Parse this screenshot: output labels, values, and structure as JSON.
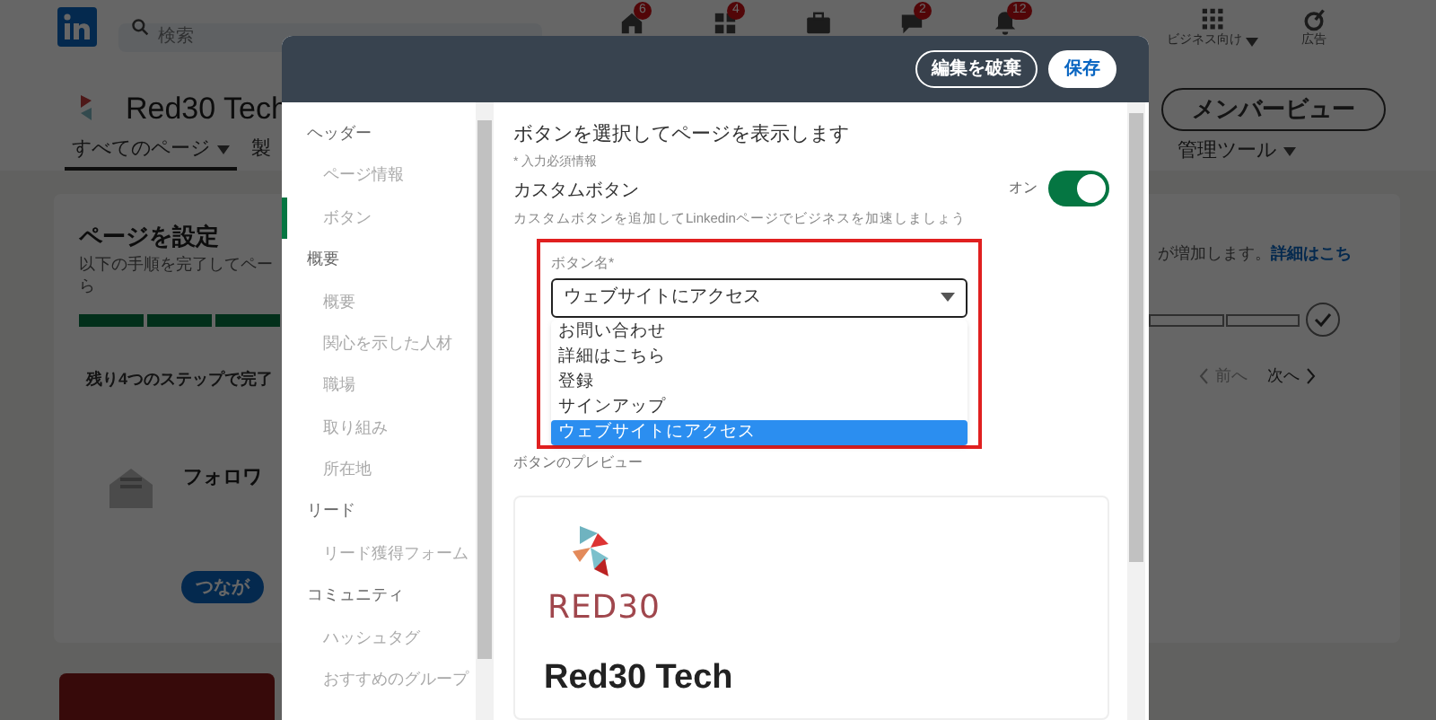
{
  "background_page": {
    "nav": {
      "search_placeholder": "検索",
      "items": [
        {
          "kind": "home",
          "badge": "6"
        },
        {
          "kind": "network",
          "badge": "4"
        },
        {
          "kind": "jobs"
        },
        {
          "kind": "messages",
          "badge": "2"
        },
        {
          "kind": "notifications",
          "badge": "12"
        }
      ],
      "business_label": "ビジネス向け",
      "ads_label": "広告"
    },
    "company_name": "Red30 Tech",
    "member_view_button": "メンバービュー",
    "tabs": [
      {
        "label": "すべてのページ",
        "selected": true
      },
      {
        "label": "製",
        "selected": false
      }
    ],
    "admin_tools": "管理ツール",
    "setup": {
      "title": "ページを設定",
      "description": "以下の手順を完了してペー",
      "description_cont": "ら",
      "description_right": "が増加します。",
      "link": "詳細はこち",
      "steps": [
        {
          "done": true
        },
        {
          "done": true
        },
        {
          "done": true
        },
        {
          "done": false
        },
        {
          "done": false
        }
      ],
      "remaining": "残り4つのステップで完了",
      "prev": "前へ",
      "next": "次へ"
    },
    "follower_card": {
      "title": "フォロワ",
      "button": "つなが"
    }
  },
  "modal": {
    "buttons": [
      {
        "label": "編集を破棄",
        "kind": "outline"
      },
      {
        "label": "保存",
        "kind": "primary"
      }
    ],
    "sidebar": [
      {
        "label": "ヘッダー",
        "children": [
          {
            "label": "ページ情報",
            "selected": false
          },
          {
            "label": "ボタン",
            "selected": true
          }
        ]
      },
      {
        "label": "概要",
        "children": [
          {
            "label": "概要",
            "selected": false
          },
          {
            "label": "関心を示した人材",
            "selected": false
          },
          {
            "label": "職場",
            "selected": false
          },
          {
            "label": "取り組み",
            "selected": false
          },
          {
            "label": "所在地",
            "selected": false
          }
        ]
      },
      {
        "label": "リード",
        "children": [
          {
            "label": "リード獲得フォーム",
            "selected": false
          }
        ]
      },
      {
        "label": "コミュニティ",
        "children": [
          {
            "label": "ハッシュタグ",
            "selected": false
          },
          {
            "label": "おすすめのグループ",
            "selected": false
          }
        ]
      }
    ],
    "heading": "ボタンを選択してページを表示します",
    "required_note": "* 入力必須情報",
    "custom_button": {
      "label": "カスタムボタン",
      "description": "カスタムボタンを追加してLinkedinページでビジネスを加速しましょう",
      "toggle_label": "オン",
      "on": true
    },
    "button_name": {
      "label": "ボタン名*",
      "value": "ウェブサイトにアクセス",
      "expanded": true,
      "options": [
        {
          "label": "お問い合わせ",
          "selected": false
        },
        {
          "label": "詳細はこちら",
          "selected": false
        },
        {
          "label": "登録",
          "selected": false
        },
        {
          "label": "サインアップ",
          "selected": false
        },
        {
          "label": "ウェブサイトにアクセス",
          "selected": true
        }
      ]
    },
    "preview": {
      "label": "ボタンのプレビュー",
      "logo_text": "RED30",
      "company_name": "Red30 Tech"
    }
  }
}
